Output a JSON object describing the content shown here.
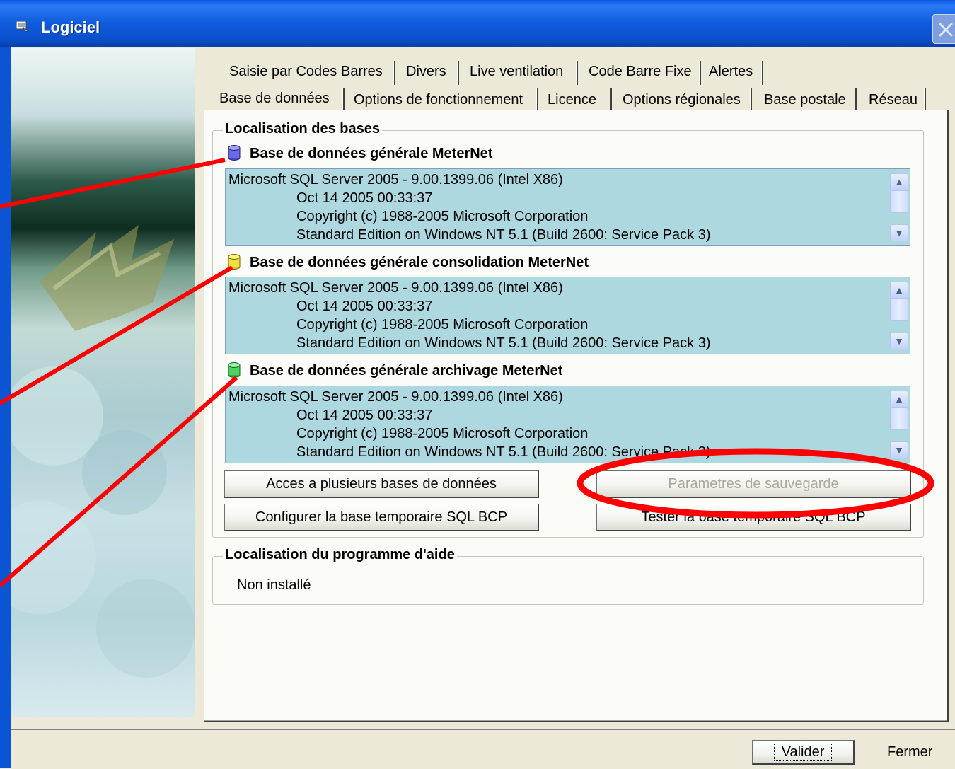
{
  "window": {
    "title": "Logiciel"
  },
  "tabs_row1": [
    {
      "label": "Saisie par Codes Barres"
    },
    {
      "label": "Divers"
    },
    {
      "label": "Live ventilation"
    },
    {
      "label": "Code Barre Fixe"
    },
    {
      "label": "Alertes"
    }
  ],
  "tabs_row2": [
    {
      "label": "Base de données"
    },
    {
      "label": "Options de fonctionnement"
    },
    {
      "label": "Licence"
    },
    {
      "label": "Options régionales"
    },
    {
      "label": "Base postale"
    },
    {
      "label": "Réseau"
    }
  ],
  "databases_group": {
    "title": "Localisation des bases",
    "databases": [
      {
        "label": "Base de données générale MeterNet",
        "icon": "database-blue-icon",
        "color": "#6a6ae8",
        "lines": [
          "Microsoft SQL Server 2005 - 9.00.1399.06 (Intel X86)",
          "Oct 14 2005 00:33:37",
          "Copyright (c) 1988-2005 Microsoft Corporation",
          "Standard Edition on Windows NT 5.1 (Build 2600: Service Pack 3)"
        ]
      },
      {
        "label": "Base de données générale consolidation MeterNet",
        "icon": "database-yellow-icon",
        "color": "#f0e040",
        "lines": [
          "Microsoft SQL Server 2005 - 9.00.1399.06 (Intel X86)",
          "Oct 14 2005 00:33:37",
          "Copyright (c) 1988-2005 Microsoft Corporation",
          "Standard Edition on Windows NT 5.1 (Build 2600: Service Pack 3)"
        ]
      },
      {
        "label": "Base de données générale archivage MeterNet",
        "icon": "database-green-icon",
        "color": "#50d060",
        "lines": [
          "Microsoft SQL Server 2005 - 9.00.1399.06 (Intel X86)",
          "Oct 14 2005 00:33:37",
          "Copyright (c) 1988-2005 Microsoft Corporation",
          "Standard Edition on Windows NT 5.1 (Build 2600: Service Pack 3)"
        ]
      }
    ],
    "buttons": {
      "multi_db": "Acces a plusieurs bases de données",
      "backup_params": "Parametres de sauvegarde",
      "config_bcp": "Configurer la base temporaire SQL BCP",
      "test_bcp": "Tester la base temporaire SQL BCP"
    }
  },
  "help_group": {
    "title": "Localisation du programme d'aide",
    "value": "Non installé"
  },
  "footer": {
    "validate": "Valider",
    "close": "Fermer"
  },
  "colors": {
    "textbox_bg": "#add8e0",
    "annotation": "#ff0000",
    "titlebar": "#0a59e0"
  }
}
